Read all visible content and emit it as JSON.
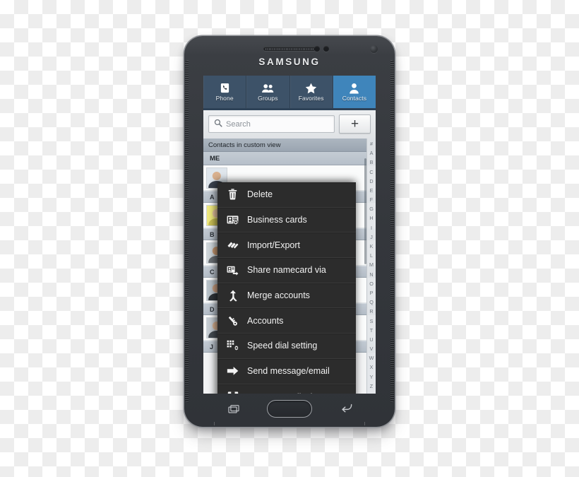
{
  "device": {
    "brand": "SAMSUNG",
    "shell_color": "#34373c",
    "bezel_highlight": "#8e9196"
  },
  "app": {
    "accent_active": "#3f85bb",
    "tabbar_color": "#3d5268",
    "tabs": [
      {
        "label": "Phone",
        "icon": "phone-handset-icon",
        "active": false
      },
      {
        "label": "Groups",
        "icon": "group-people-icon",
        "active": false
      },
      {
        "label": "Favorites",
        "icon": "star-icon",
        "active": false
      },
      {
        "label": "Contacts",
        "icon": "person-icon",
        "active": true
      }
    ],
    "search": {
      "placeholder": "Search",
      "icon": "search-icon"
    },
    "add_button": {
      "label": "+",
      "icon": "plus-icon"
    },
    "list": {
      "custom_view_label": "Contacts in custom view",
      "me_label": "ME",
      "sections": [
        {
          "letter": "",
          "contacts": [
            {
              "name": "",
              "hair": "#5b4636",
              "skin": "#d9b18f",
              "bg": "#dfe6ec",
              "shirt": "#3d4450"
            }
          ]
        },
        {
          "letter": "A",
          "contacts": [
            {
              "name": "",
              "hair": "#e8dc6a",
              "skin": "#e6c4a0",
              "bg": "#efe97e",
              "shirt": "#c9bf55"
            }
          ]
        },
        {
          "letter": "B",
          "contacts": [
            {
              "name": "",
              "hair": "#2e2320",
              "skin": "#c89a73",
              "bg": "#cfd6da",
              "shirt": "#6a6f74"
            }
          ]
        },
        {
          "letter": "C",
          "contacts": [
            {
              "name": "",
              "hair": "#4a4a4a",
              "skin": "#d3a versus",
              "bg": "#b9c3ca",
              "shirt": "#2f3439"
            }
          ]
        },
        {
          "letter": "D",
          "contacts": [
            {
              "name": "",
              "hair": "#8d8d8d",
              "skin": "#d8b394",
              "bg": "#c7ced4",
              "shirt": "#454b52"
            }
          ]
        },
        {
          "letter": "J",
          "contacts": []
        }
      ],
      "index_letters": [
        "#",
        "A",
        "B",
        "C",
        "D",
        "E",
        "F",
        "G",
        "H",
        "I",
        "J",
        "K",
        "L",
        "M",
        "N",
        "O",
        "P",
        "Q",
        "R",
        "S",
        "T",
        "U",
        "V",
        "W",
        "X",
        "Y",
        "Z"
      ]
    },
    "context_menu": {
      "background": "#2c2c2c",
      "items": [
        {
          "label": "Delete",
          "icon": "trash-icon",
          "clipped": false
        },
        {
          "label": "Business cards",
          "icon": "business-card-icon",
          "clipped": false
        },
        {
          "label": "Import/Export",
          "icon": "import-export-icon",
          "clipped": false
        },
        {
          "label": "Share namecard via",
          "icon": "share-card-icon",
          "clipped": false
        },
        {
          "label": "Merge accounts",
          "icon": "merge-arrow-icon",
          "clipped": false
        },
        {
          "label": "Accounts",
          "icon": "key-icon",
          "clipped": false
        },
        {
          "label": "Speed dial setting",
          "icon": "keypad-gear-icon",
          "clipped": false
        },
        {
          "label": "Send message/email",
          "icon": "arrow-right-icon",
          "clipped": false
        },
        {
          "label": "Contacts to display",
          "icon": "display-icon",
          "clipped": true
        }
      ]
    }
  },
  "nav_bar": {
    "recents": "recents-icon",
    "home": "home-button",
    "back": "back-icon"
  }
}
